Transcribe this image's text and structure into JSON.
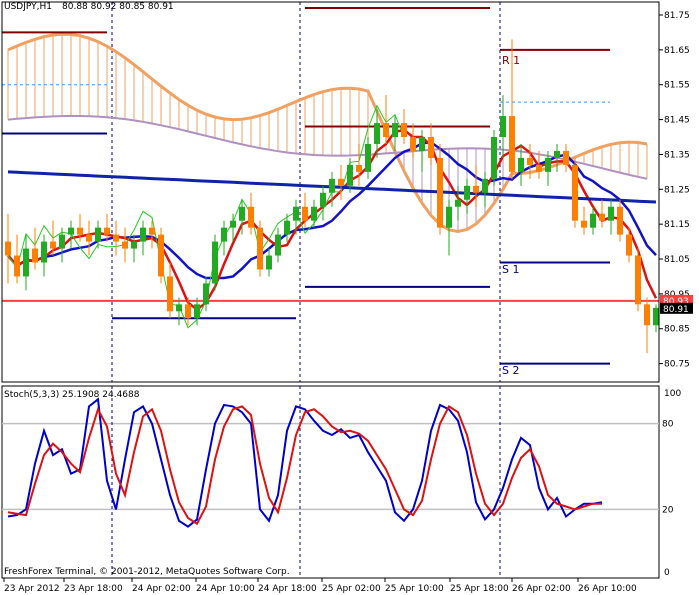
{
  "header": {
    "symbol": "USDJPY,H1",
    "ohlc": "80.88 80.92 80.85 80.91"
  },
  "stoch_label": "Stoch(5,3,3) 25.1908 24.4688",
  "footer_text": "FreshForex Terminal, © 2001-2012, MetaQuotes Software Corp.",
  "colors": {
    "bull": "#22aa22",
    "bear": "#ff7f00",
    "kijun": "#1111cc",
    "tenkan": "#dd1111",
    "pivot_r": "#800000",
    "pivot_s": "#000080",
    "cloud_a": "#f0a060",
    "cloud_b": "#b090c0",
    "stoch_main": "#0000cc",
    "stoch_signal": "#dd1111",
    "chikou": "#22cc22",
    "bid_line": "#ff4040"
  },
  "chart_data": [
    {
      "type": "candlestick",
      "symbol": "USDJPY",
      "timeframe": "H1",
      "ylim": [
        80.65,
        81.85
      ],
      "y_ticks": [
        "81.75",
        "81.65",
        "81.55",
        "81.45",
        "81.35",
        "81.25",
        "81.15",
        "81.05",
        "80.95",
        "80.85",
        "80.75"
      ],
      "current_price_label": "80.91",
      "red_price_label": "80.93",
      "x_tick_labels": [
        "23 Apr 2012",
        "23 Apr 18:00",
        "24 Apr 02:00",
        "24 Apr 10:00",
        "24 Apr 18:00",
        "25 Apr 02:00",
        "25 Apr 10:00",
        "25 Apr 18:00",
        "26 Apr 02:00",
        "26 Apr 10:00"
      ],
      "pivot_labels": [
        "R 1",
        "S 1",
        "S 2"
      ],
      "candles": [
        {
          "o": 81.1,
          "h": 81.18,
          "l": 80.98,
          "c": 81.06
        },
        {
          "o": 81.06,
          "h": 81.12,
          "l": 80.98,
          "c": 81.0
        },
        {
          "o": 81.0,
          "h": 81.12,
          "l": 80.96,
          "c": 81.08
        },
        {
          "o": 81.08,
          "h": 81.14,
          "l": 81.02,
          "c": 81.04
        },
        {
          "o": 81.04,
          "h": 81.12,
          "l": 81.0,
          "c": 81.1
        },
        {
          "o": 81.1,
          "h": 81.16,
          "l": 81.06,
          "c": 81.08
        },
        {
          "o": 81.08,
          "h": 81.14,
          "l": 81.04,
          "c": 81.12
        },
        {
          "o": 81.12,
          "h": 81.16,
          "l": 81.08,
          "c": 81.14
        },
        {
          "o": 81.14,
          "h": 81.18,
          "l": 81.1,
          "c": 81.12
        },
        {
          "o": 81.12,
          "h": 81.16,
          "l": 81.06,
          "c": 81.1
        },
        {
          "o": 81.1,
          "h": 81.16,
          "l": 81.08,
          "c": 81.14
        },
        {
          "o": 81.14,
          "h": 81.18,
          "l": 81.1,
          "c": 81.12
        },
        {
          "o": 81.12,
          "h": 81.16,
          "l": 81.06,
          "c": 81.1
        },
        {
          "o": 81.1,
          "h": 81.14,
          "l": 81.04,
          "c": 81.08
        },
        {
          "o": 81.08,
          "h": 81.12,
          "l": 81.04,
          "c": 81.1
        },
        {
          "o": 81.1,
          "h": 81.16,
          "l": 81.06,
          "c": 81.14
        },
        {
          "o": 81.14,
          "h": 81.16,
          "l": 81.08,
          "c": 81.12
        },
        {
          "o": 81.12,
          "h": 81.14,
          "l": 80.98,
          "c": 81.0
        },
        {
          "o": 81.0,
          "h": 81.04,
          "l": 80.88,
          "c": 80.9
        },
        {
          "o": 80.9,
          "h": 80.94,
          "l": 80.86,
          "c": 80.92
        },
        {
          "o": 80.92,
          "h": 80.94,
          "l": 80.86,
          "c": 80.88
        },
        {
          "o": 80.88,
          "h": 80.94,
          "l": 80.86,
          "c": 80.92
        },
        {
          "o": 80.92,
          "h": 81.0,
          "l": 80.9,
          "c": 80.98
        },
        {
          "o": 80.98,
          "h": 81.12,
          "l": 80.96,
          "c": 81.1
        },
        {
          "o": 81.1,
          "h": 81.16,
          "l": 81.06,
          "c": 81.14
        },
        {
          "o": 81.14,
          "h": 81.18,
          "l": 81.1,
          "c": 81.16
        },
        {
          "o": 81.16,
          "h": 81.22,
          "l": 81.12,
          "c": 81.2
        },
        {
          "o": 81.2,
          "h": 81.24,
          "l": 81.12,
          "c": 81.14
        },
        {
          "o": 81.14,
          "h": 81.16,
          "l": 81.0,
          "c": 81.02
        },
        {
          "o": 81.02,
          "h": 81.08,
          "l": 81.0,
          "c": 81.06
        },
        {
          "o": 81.06,
          "h": 81.14,
          "l": 81.04,
          "c": 81.12
        },
        {
          "o": 81.12,
          "h": 81.18,
          "l": 81.1,
          "c": 81.16
        },
        {
          "o": 81.16,
          "h": 81.22,
          "l": 81.12,
          "c": 81.2
        },
        {
          "o": 81.2,
          "h": 81.24,
          "l": 81.14,
          "c": 81.16
        },
        {
          "o": 81.16,
          "h": 81.22,
          "l": 81.14,
          "c": 81.2
        },
        {
          "o": 81.2,
          "h": 81.26,
          "l": 81.16,
          "c": 81.24
        },
        {
          "o": 81.24,
          "h": 81.3,
          "l": 81.2,
          "c": 81.28
        },
        {
          "o": 81.28,
          "h": 81.32,
          "l": 81.22,
          "c": 81.26
        },
        {
          "o": 81.26,
          "h": 81.34,
          "l": 81.24,
          "c": 81.32
        },
        {
          "o": 81.32,
          "h": 81.38,
          "l": 81.26,
          "c": 81.3
        },
        {
          "o": 81.3,
          "h": 81.4,
          "l": 81.28,
          "c": 81.38
        },
        {
          "o": 81.38,
          "h": 81.48,
          "l": 81.34,
          "c": 81.44
        },
        {
          "o": 81.44,
          "h": 81.52,
          "l": 81.38,
          "c": 81.4
        },
        {
          "o": 81.4,
          "h": 81.46,
          "l": 81.36,
          "c": 81.44
        },
        {
          "o": 81.44,
          "h": 81.48,
          "l": 81.38,
          "c": 81.4
        },
        {
          "o": 81.4,
          "h": 81.44,
          "l": 81.34,
          "c": 81.36
        },
        {
          "o": 81.36,
          "h": 81.42,
          "l": 81.3,
          "c": 81.4
        },
        {
          "o": 81.4,
          "h": 81.44,
          "l": 81.32,
          "c": 81.34
        },
        {
          "o": 81.34,
          "h": 81.38,
          "l": 81.12,
          "c": 81.14
        },
        {
          "o": 81.14,
          "h": 81.22,
          "l": 81.06,
          "c": 81.2
        },
        {
          "o": 81.2,
          "h": 81.26,
          "l": 81.16,
          "c": 81.22
        },
        {
          "o": 81.22,
          "h": 81.28,
          "l": 81.18,
          "c": 81.26
        },
        {
          "o": 81.26,
          "h": 81.32,
          "l": 81.2,
          "c": 81.24
        },
        {
          "o": 81.24,
          "h": 81.3,
          "l": 81.2,
          "c": 81.28
        },
        {
          "o": 81.28,
          "h": 81.42,
          "l": 81.26,
          "c": 81.4
        },
        {
          "o": 81.4,
          "h": 81.52,
          "l": 81.34,
          "c": 81.46
        },
        {
          "o": 81.46,
          "h": 81.68,
          "l": 81.28,
          "c": 81.3
        },
        {
          "o": 81.3,
          "h": 81.38,
          "l": 81.26,
          "c": 81.34
        },
        {
          "o": 81.34,
          "h": 81.38,
          "l": 81.28,
          "c": 81.32
        },
        {
          "o": 81.32,
          "h": 81.36,
          "l": 81.28,
          "c": 81.3
        },
        {
          "o": 81.3,
          "h": 81.36,
          "l": 81.26,
          "c": 81.34
        },
        {
          "o": 81.34,
          "h": 81.38,
          "l": 81.3,
          "c": 81.36
        },
        {
          "o": 81.36,
          "h": 81.38,
          "l": 81.3,
          "c": 81.32
        },
        {
          "o": 81.32,
          "h": 81.34,
          "l": 81.14,
          "c": 81.16
        },
        {
          "o": 81.16,
          "h": 81.2,
          "l": 81.12,
          "c": 81.14
        },
        {
          "o": 81.14,
          "h": 81.2,
          "l": 81.12,
          "c": 81.18
        },
        {
          "o": 81.18,
          "h": 81.22,
          "l": 81.14,
          "c": 81.16
        },
        {
          "o": 81.16,
          "h": 81.22,
          "l": 81.12,
          "c": 81.2
        },
        {
          "o": 81.2,
          "h": 81.22,
          "l": 81.1,
          "c": 81.12
        },
        {
          "o": 81.12,
          "h": 81.14,
          "l": 81.04,
          "c": 81.06
        },
        {
          "o": 81.06,
          "h": 81.08,
          "l": 80.9,
          "c": 80.92
        },
        {
          "o": 80.92,
          "h": 80.94,
          "l": 80.78,
          "c": 80.86
        },
        {
          "o": 80.86,
          "h": 80.92,
          "l": 80.84,
          "c": 80.91
        }
      ],
      "series": [
        {
          "name": "Stoch main",
          "values": [
            15,
            16,
            20,
            52,
            75,
            58,
            62,
            45,
            48,
            92,
            97,
            40,
            20,
            55,
            88,
            92,
            80,
            55,
            30,
            12,
            8,
            13,
            48,
            80,
            93,
            92,
            88,
            80,
            20,
            12,
            30,
            75,
            92,
            90,
            82,
            75,
            72,
            76,
            70,
            72,
            60,
            50,
            40,
            18,
            12,
            20,
            40,
            75,
            93,
            90,
            82,
            60,
            25,
            13,
            20,
            35,
            55,
            70,
            65,
            35,
            20,
            28,
            15,
            20,
            24,
            24,
            25
          ]
        },
        {
          "name": "Stoch signal",
          "values": [
            18,
            17,
            16,
            38,
            58,
            66,
            60,
            52,
            46,
            70,
            90,
            78,
            45,
            30,
            60,
            85,
            90,
            75,
            48,
            25,
            14,
            10,
            22,
            55,
            78,
            90,
            92,
            86,
            52,
            28,
            18,
            42,
            72,
            88,
            90,
            85,
            78,
            74,
            75,
            73,
            68,
            58,
            48,
            34,
            20,
            16,
            26,
            55,
            80,
            92,
            88,
            72,
            45,
            24,
            16,
            24,
            42,
            56,
            62,
            50,
            30,
            24,
            22,
            20,
            22,
            24,
            24
          ]
        }
      ]
    }
  ]
}
